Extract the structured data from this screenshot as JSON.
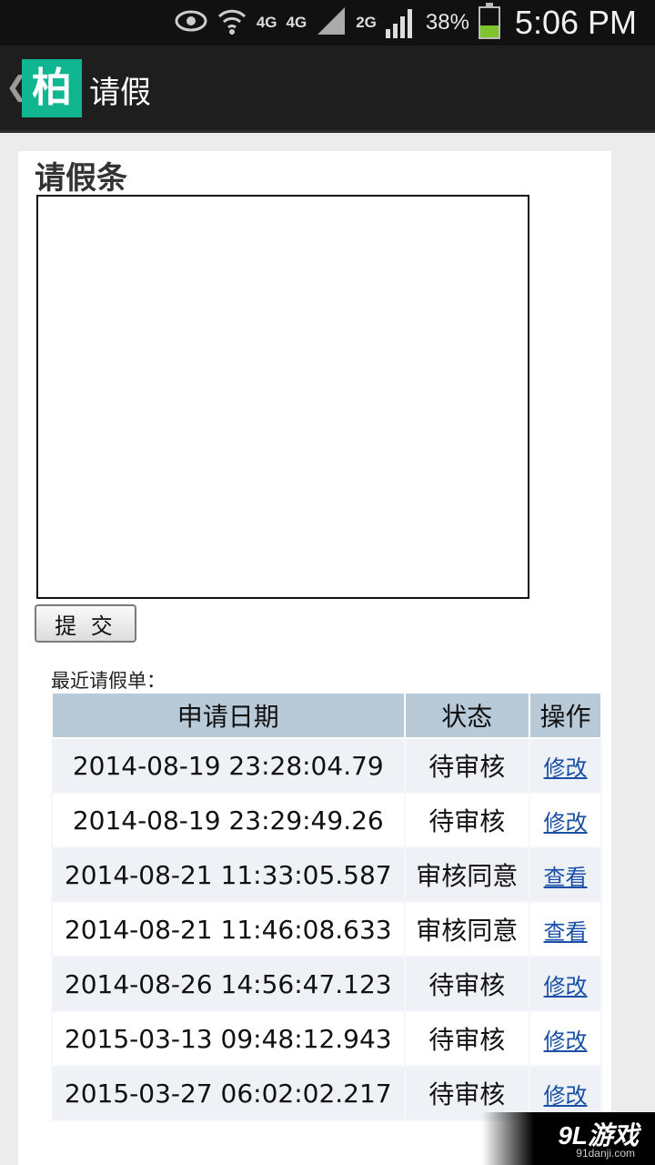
{
  "status_bar": {
    "network_1": "4G",
    "network_2": "4G",
    "network_3": "2G",
    "battery": "38%",
    "time": "5:06 PM"
  },
  "app_bar": {
    "logo_text": "柏",
    "title": "请假"
  },
  "form": {
    "heading": "请假条",
    "textarea_value": "",
    "submit_label": "提 交"
  },
  "recent": {
    "label": "最近请假单：",
    "headers": {
      "date": "申请日期",
      "status": "状态",
      "action": "操作"
    },
    "rows": [
      {
        "date": "2014-08-19 23:28:04.79",
        "status": "待审核",
        "action": "修改"
      },
      {
        "date": "2014-08-19 23:29:49.26",
        "status": "待审核",
        "action": "修改"
      },
      {
        "date": "2014-08-21 11:33:05.587",
        "status": "审核同意",
        "action": "查看"
      },
      {
        "date": "2014-08-21 11:46:08.633",
        "status": "审核同意",
        "action": "查看"
      },
      {
        "date": "2014-08-26 14:56:47.123",
        "status": "待审核",
        "action": "修改"
      },
      {
        "date": "2015-03-13 09:48:12.943",
        "status": "待审核",
        "action": "修改"
      },
      {
        "date": "2015-03-27 06:02:02.217",
        "status": "待审核",
        "action": "修改"
      }
    ]
  },
  "watermark": {
    "main": "9L游戏",
    "sub": "91danji.com"
  }
}
